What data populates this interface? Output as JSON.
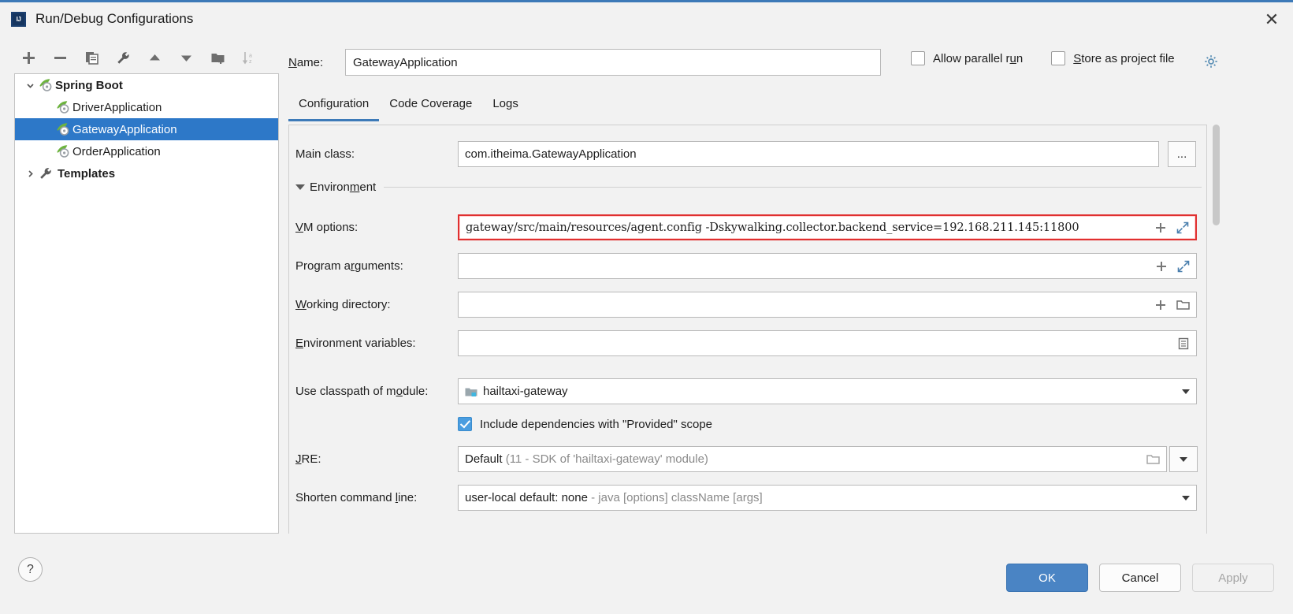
{
  "window": {
    "title": "Run/Debug Configurations",
    "app_icon": "intellij-idea-icon",
    "close_icon": "close-icon"
  },
  "tree_toolbar": {
    "buttons": [
      {
        "name": "add-configuration-button",
        "icon": "plus-icon",
        "label": "+"
      },
      {
        "name": "remove-configuration-button",
        "icon": "minus-icon",
        "label": "−"
      },
      {
        "name": "copy-configuration-button",
        "icon": "copy-icon",
        "label": "Copy"
      },
      {
        "name": "edit-templates-button",
        "icon": "wrench-icon",
        "label": "Edit Templates"
      },
      {
        "name": "move-up-button",
        "icon": "arrow-up-icon",
        "label": "Move Up"
      },
      {
        "name": "move-down-button",
        "icon": "arrow-down-icon",
        "label": "Move Down"
      },
      {
        "name": "move-into-folder-button",
        "icon": "folder-add-icon",
        "label": "Create Folder"
      },
      {
        "name": "sort-configurations-button",
        "icon": "sort-alpha-icon",
        "label": "Sort"
      }
    ]
  },
  "tree": {
    "nodes": [
      {
        "label": "Spring Boot",
        "icon": "spring-boot-icon",
        "level": 0,
        "expanded": true,
        "bold": true,
        "selected": false
      },
      {
        "label": "DriverApplication",
        "icon": "spring-boot-icon",
        "level": 1,
        "selected": false
      },
      {
        "label": "GatewayApplication",
        "icon": "spring-boot-icon",
        "level": 1,
        "selected": true
      },
      {
        "label": "OrderApplication",
        "icon": "spring-boot-icon",
        "level": 1,
        "selected": false
      },
      {
        "label": "Templates",
        "icon": "wrench-icon",
        "level": 0,
        "expanded": false,
        "bold": true,
        "selected": false
      }
    ]
  },
  "help": {
    "label": "?",
    "icon": "help-icon"
  },
  "name_row": {
    "label": "Name:",
    "mnemonic": "N",
    "value": "GatewayApplication",
    "placeholder": "",
    "allow_parallel_run": {
      "label": "Allow parallel run",
      "mnemonic": "u",
      "checked": false
    },
    "store_as_project_file": {
      "label": "Store as project file",
      "mnemonic": "S",
      "checked": false
    },
    "settings_icon": "gear-icon"
  },
  "tabs": [
    {
      "label": "Configuration",
      "active": true
    },
    {
      "label": "Code Coverage",
      "active": false
    },
    {
      "label": "Logs",
      "active": false
    }
  ],
  "form": {
    "main_class": {
      "label": "Main class:",
      "value": "com.itheima.GatewayApplication",
      "browse_label": "...",
      "browse_icon": "ellipsis-icon"
    },
    "environment_section": {
      "label": "Environment",
      "mnemonic": "m",
      "expanded": true,
      "toggle_icon": "triangle-down-icon"
    },
    "vm_options": {
      "label": "VM options:",
      "mnemonic": "V",
      "value": "gateway/src/main/resources/agent.config -Dskywalking.collector.backend_service=192.168.211.145:11800",
      "error": true,
      "error_color": "#e03030",
      "icons": [
        "macro-add-icon",
        "expand-editor-icon"
      ]
    },
    "program_arguments": {
      "label": "Program arguments:",
      "mnemonic": "r",
      "value": "",
      "icons": [
        "macro-add-icon",
        "expand-editor-icon"
      ]
    },
    "working_directory": {
      "label": "Working directory:",
      "mnemonic": "W",
      "value": "",
      "icons": [
        "macro-add-icon",
        "folder-icon"
      ]
    },
    "environment_variables": {
      "label": "Environment variables:",
      "mnemonic": "E",
      "value": "",
      "icons": [
        "list-edit-icon"
      ]
    },
    "use_classpath_of_module": {
      "label": "Use classpath of module:",
      "mnemonic": "o",
      "value": "hailtaxi-gateway",
      "value_icon": "module-icon",
      "dropdown_icon": "chevron-down-icon"
    },
    "include_dependencies": {
      "label": "Include dependencies with \"Provided\" scope",
      "checked": true
    },
    "jre": {
      "label": "JRE:",
      "mnemonic": "J",
      "value": "Default",
      "value_hint": "(11 - SDK of 'hailtaxi-gateway' module)",
      "browse_icon": "folder-icon",
      "dropdown_icon": "chevron-down-icon"
    },
    "shorten_command_line": {
      "label": "Shorten command line:",
      "mnemonic": "l",
      "value": "user-local default: none",
      "value_hint": "- java [options] className [args]",
      "dropdown_icon": "chevron-down-icon"
    }
  },
  "scrollbar": {
    "name": "vertical-scrollbar"
  },
  "buttons": {
    "ok": "OK",
    "cancel": "Cancel",
    "apply": "Apply",
    "apply_disabled": true
  },
  "colors": {
    "accent": "#3d7ab8",
    "selection": "#2d78c8",
    "checkbox_checked": "#4a9de0",
    "error_border": "#e03030",
    "primary_button": "#4a84c4"
  }
}
